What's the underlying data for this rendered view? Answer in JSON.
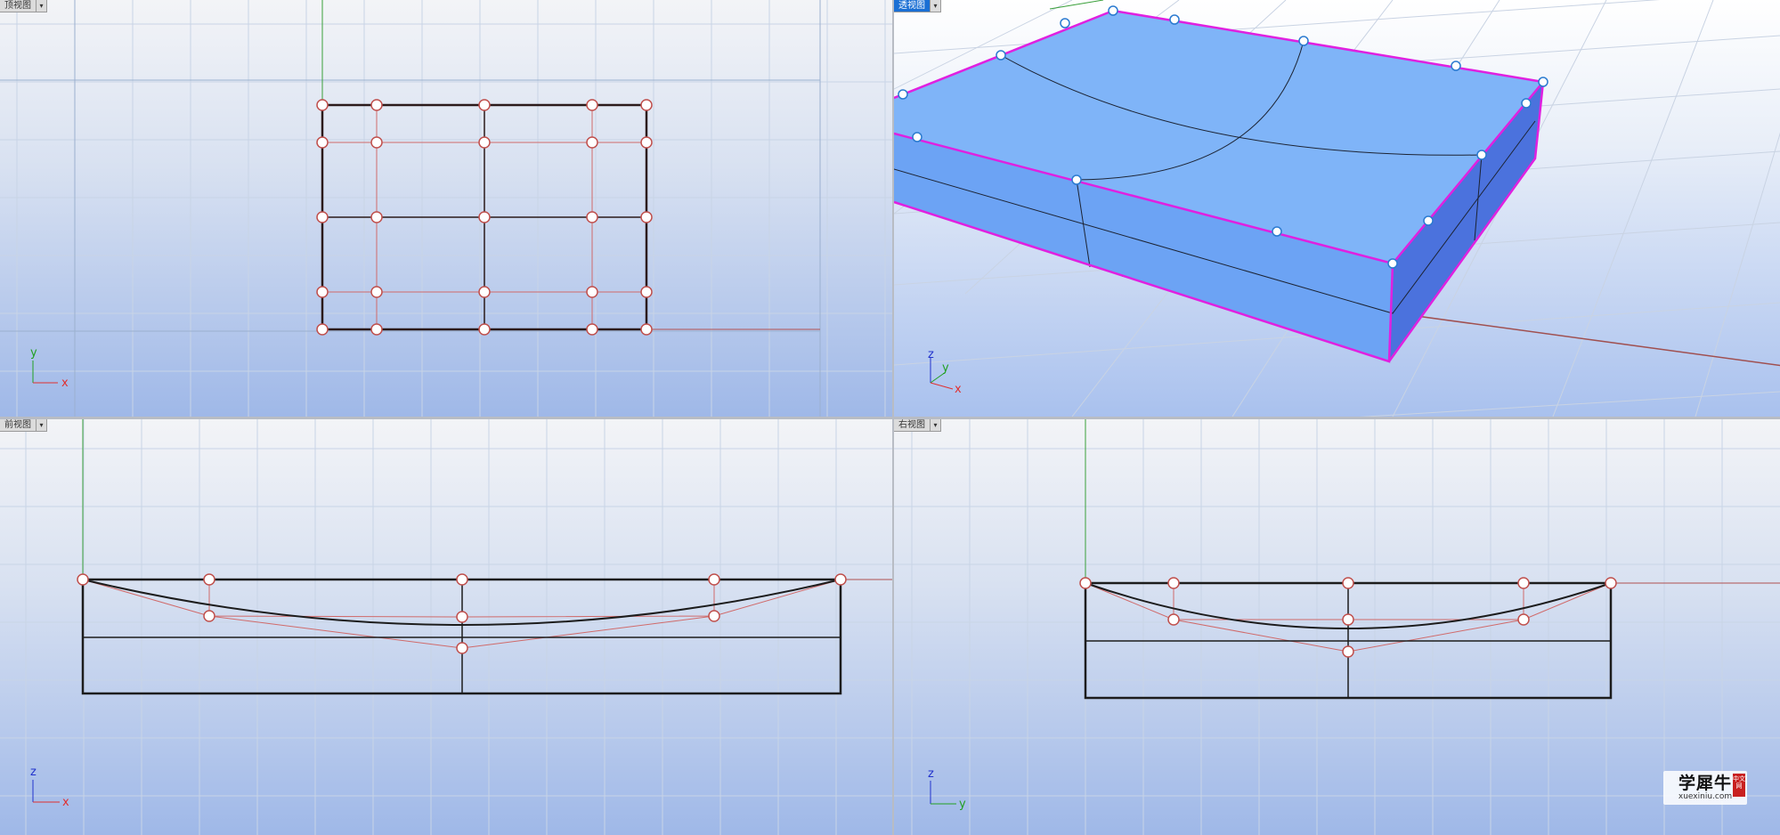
{
  "viewports": {
    "top": {
      "label": "顶视图",
      "axis_a": "y",
      "axis_b": "x"
    },
    "perspective": {
      "label": "透视图",
      "axis_a": "z",
      "axis_b": "y",
      "axis_c": "x"
    },
    "front": {
      "label": "前视图",
      "axis_a": "z",
      "axis_b": "x"
    },
    "right": {
      "label": "右视图",
      "axis_a": "z",
      "axis_b": "y"
    }
  },
  "menu_arrow": "▾",
  "colors": {
    "x_axis": "#e03030",
    "y_axis": "#22a022",
    "z_axis": "#2233cc",
    "edge_highlight": "#e020e0",
    "surface": "#6fa8f7",
    "control_point": "#c0504d"
  },
  "watermark": {
    "title": "学犀牛",
    "url": "xuexiniu.com",
    "stamp": "中文网"
  }
}
